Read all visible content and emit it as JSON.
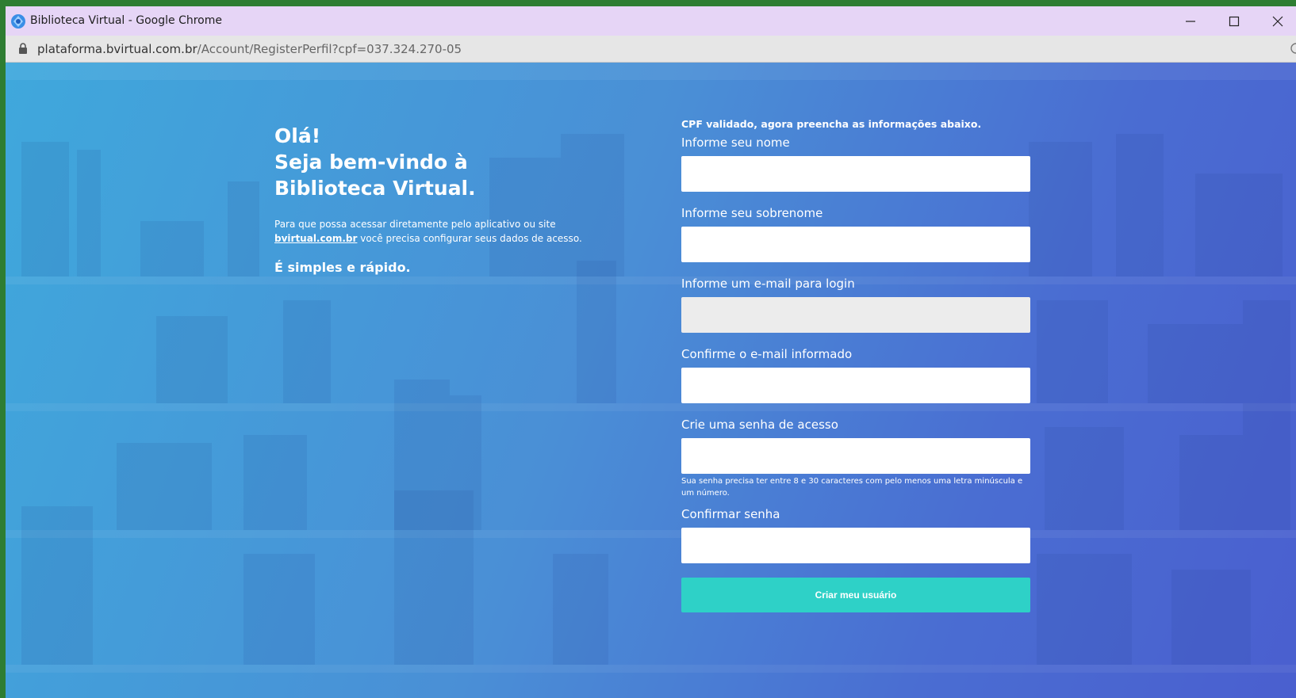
{
  "window": {
    "title": "Biblioteca Virtual - Google Chrome",
    "url_host": "plataforma.bvirtual.com.br",
    "url_path": "/Account/RegisterPerfil?cpf=037.324.270-05"
  },
  "intro": {
    "heading_line1": "Olá!",
    "heading_line2": "Seja bem-vindo à",
    "heading_line3": "Biblioteca Virtual.",
    "description_before": "Para que possa acessar diretamente pelo aplicativo ou site",
    "description_link": "bvirtual.com.br",
    "description_after": " você precisa configurar seus dados de acesso.",
    "tagline": "É simples e rápido."
  },
  "form": {
    "notice": "CPF validado, agora preencha as informações abaixo.",
    "name_label": "Informe seu nome",
    "surname_label": "Informe seu sobrenome",
    "email_label": "Informe um e-mail para login",
    "email_confirm_label": "Confirme o e-mail informado",
    "password_label": "Crie uma senha de acesso",
    "password_hint": "Sua senha precisa ter entre 8 e 30 caracteres com pelo menos uma letra minúscula e um número.",
    "password_confirm_label": "Confirmar senha",
    "submit_label": "Criar meu usuário"
  },
  "colors": {
    "titlebar": "#e6d5f6",
    "gradient_start": "#3fa8dc",
    "gradient_end": "#4a5fcf",
    "submit_button": "#2ed1c7"
  }
}
